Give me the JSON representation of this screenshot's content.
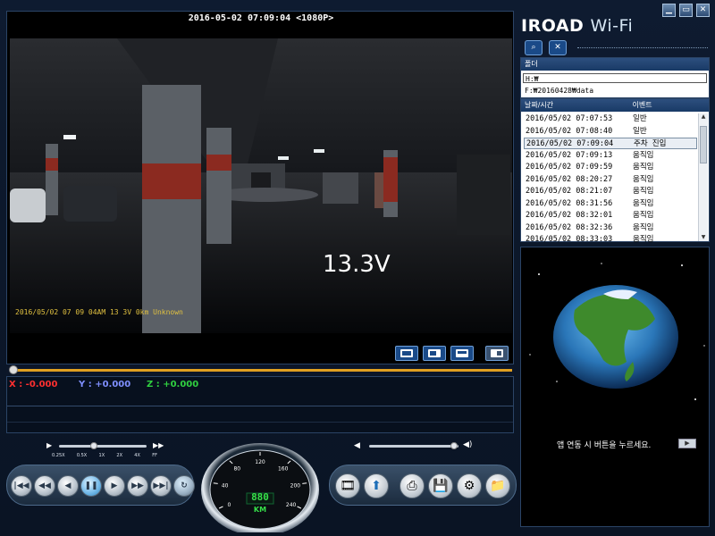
{
  "app": {
    "brand_main": "IROAD",
    "brand_sub": "Wi-Fi",
    "window_buttons": {
      "minimize": "▁",
      "restore": "▭",
      "close": "✕"
    }
  },
  "video": {
    "title": "2016-05-02 07:09:04 <1080P>",
    "voltage_overlay": "13.3V",
    "timestamp_overlay": "2016/05/02 07 09 04AM 13 3V   0km Unknown",
    "layout_buttons": [
      "single-view-icon",
      "dual-view-icon",
      "pip-view-icon",
      "toggle-view-icon"
    ]
  },
  "gsensor": {
    "x_label": "X : -0.000",
    "y_label": "Y : +0.000",
    "z_label": "Z : +0.000",
    "colors": {
      "x": "#ff3030",
      "y": "#7f8fff",
      "z": "#30d040"
    }
  },
  "speed_control": {
    "labels": [
      "0.25X",
      "0.5X",
      "1X",
      "2X",
      "4X",
      "FF"
    ],
    "selected": "1X"
  },
  "volume": {
    "level": 0.95
  },
  "speedometer": {
    "ticks": [
      "0",
      "40",
      "80",
      "120",
      "160",
      "200",
      "240"
    ],
    "digits": "880",
    "unit": "KM"
  },
  "right": {
    "folder_header": "폴더",
    "folders": [
      "H:₩",
      "F:₩20160428₩data"
    ],
    "event_headers": {
      "datetime": "날짜/시간",
      "event": "이벤트"
    },
    "events": [
      {
        "time": "2016/05/02 07:07:53",
        "type": "일반"
      },
      {
        "time": "2016/05/02 07:08:40",
        "type": "일반"
      },
      {
        "time": "2016/05/02 07:09:04",
        "type": "주차 진입"
      },
      {
        "time": "2016/05/02 07:09:13",
        "type": "움직임"
      },
      {
        "time": "2016/05/02 07:09:59",
        "type": "움직임"
      },
      {
        "time": "2016/05/02 08:20:27",
        "type": "움직임"
      },
      {
        "time": "2016/05/02 08:21:07",
        "type": "움직임"
      },
      {
        "time": "2016/05/02 08:31:56",
        "type": "움직임"
      },
      {
        "time": "2016/05/02 08:32:01",
        "type": "움직임"
      },
      {
        "time": "2016/05/02 08:32:36",
        "type": "움직임"
      },
      {
        "time": "2016/05/02 08:33:03",
        "type": "움직임"
      }
    ],
    "selected_index": 2,
    "map_message": "앱 연동 시 버튼을 누르세요."
  }
}
